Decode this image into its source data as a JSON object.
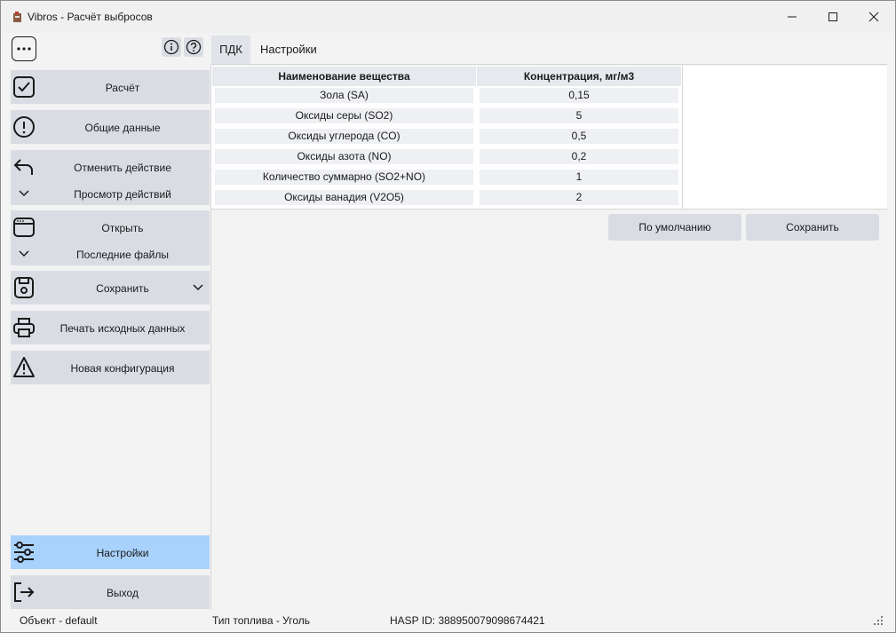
{
  "window": {
    "title": "Vibros - Расчёт выбросов"
  },
  "sidebar": {
    "items": [
      {
        "label": "Расчёт",
        "icon": "check-square-icon"
      },
      {
        "label": "Общие данные",
        "icon": "exclamation-circle-icon"
      },
      {
        "label": "Отменить действие",
        "sub_label": "Просмотр действий",
        "icon": "undo-icon"
      },
      {
        "label": "Открыть",
        "sub_label": "Последние файлы",
        "icon": "window-icon"
      },
      {
        "label": "Сохранить",
        "icon": "save-icon"
      },
      {
        "label": "Печать исходных данных",
        "icon": "printer-icon"
      },
      {
        "label": "Новая конфигурация",
        "icon": "warning-triangle-icon"
      }
    ],
    "settings_label": "Настройки",
    "exit_label": "Выход"
  },
  "tabs": [
    {
      "label": "ПДК",
      "active": true
    },
    {
      "label": "Настройки",
      "active": false
    }
  ],
  "table": {
    "headers": [
      "Наименование вещества",
      "Концентрация, мг/м3"
    ],
    "rows": [
      [
        "Зола (SA)",
        "0,15"
      ],
      [
        "Оксиды серы (SO2)",
        "5"
      ],
      [
        "Оксиды углерода (CO)",
        "0,5"
      ],
      [
        "Оксиды азота (NO)",
        "0,2"
      ],
      [
        "Количество суммарно (SO2+NO)",
        "1"
      ],
      [
        "Оксиды ванадия (V2O5)",
        "2"
      ]
    ]
  },
  "buttons": {
    "default_label": "По умолчанию",
    "save_label": "Сохранить"
  },
  "status": {
    "object": "Объект - default",
    "fuel": "Тип топлива - Уголь",
    "hasp": "HASP ID: 388950079098674421"
  },
  "colors": {
    "accent": "#a8d1fb",
    "button_bg": "#d9dde3"
  }
}
